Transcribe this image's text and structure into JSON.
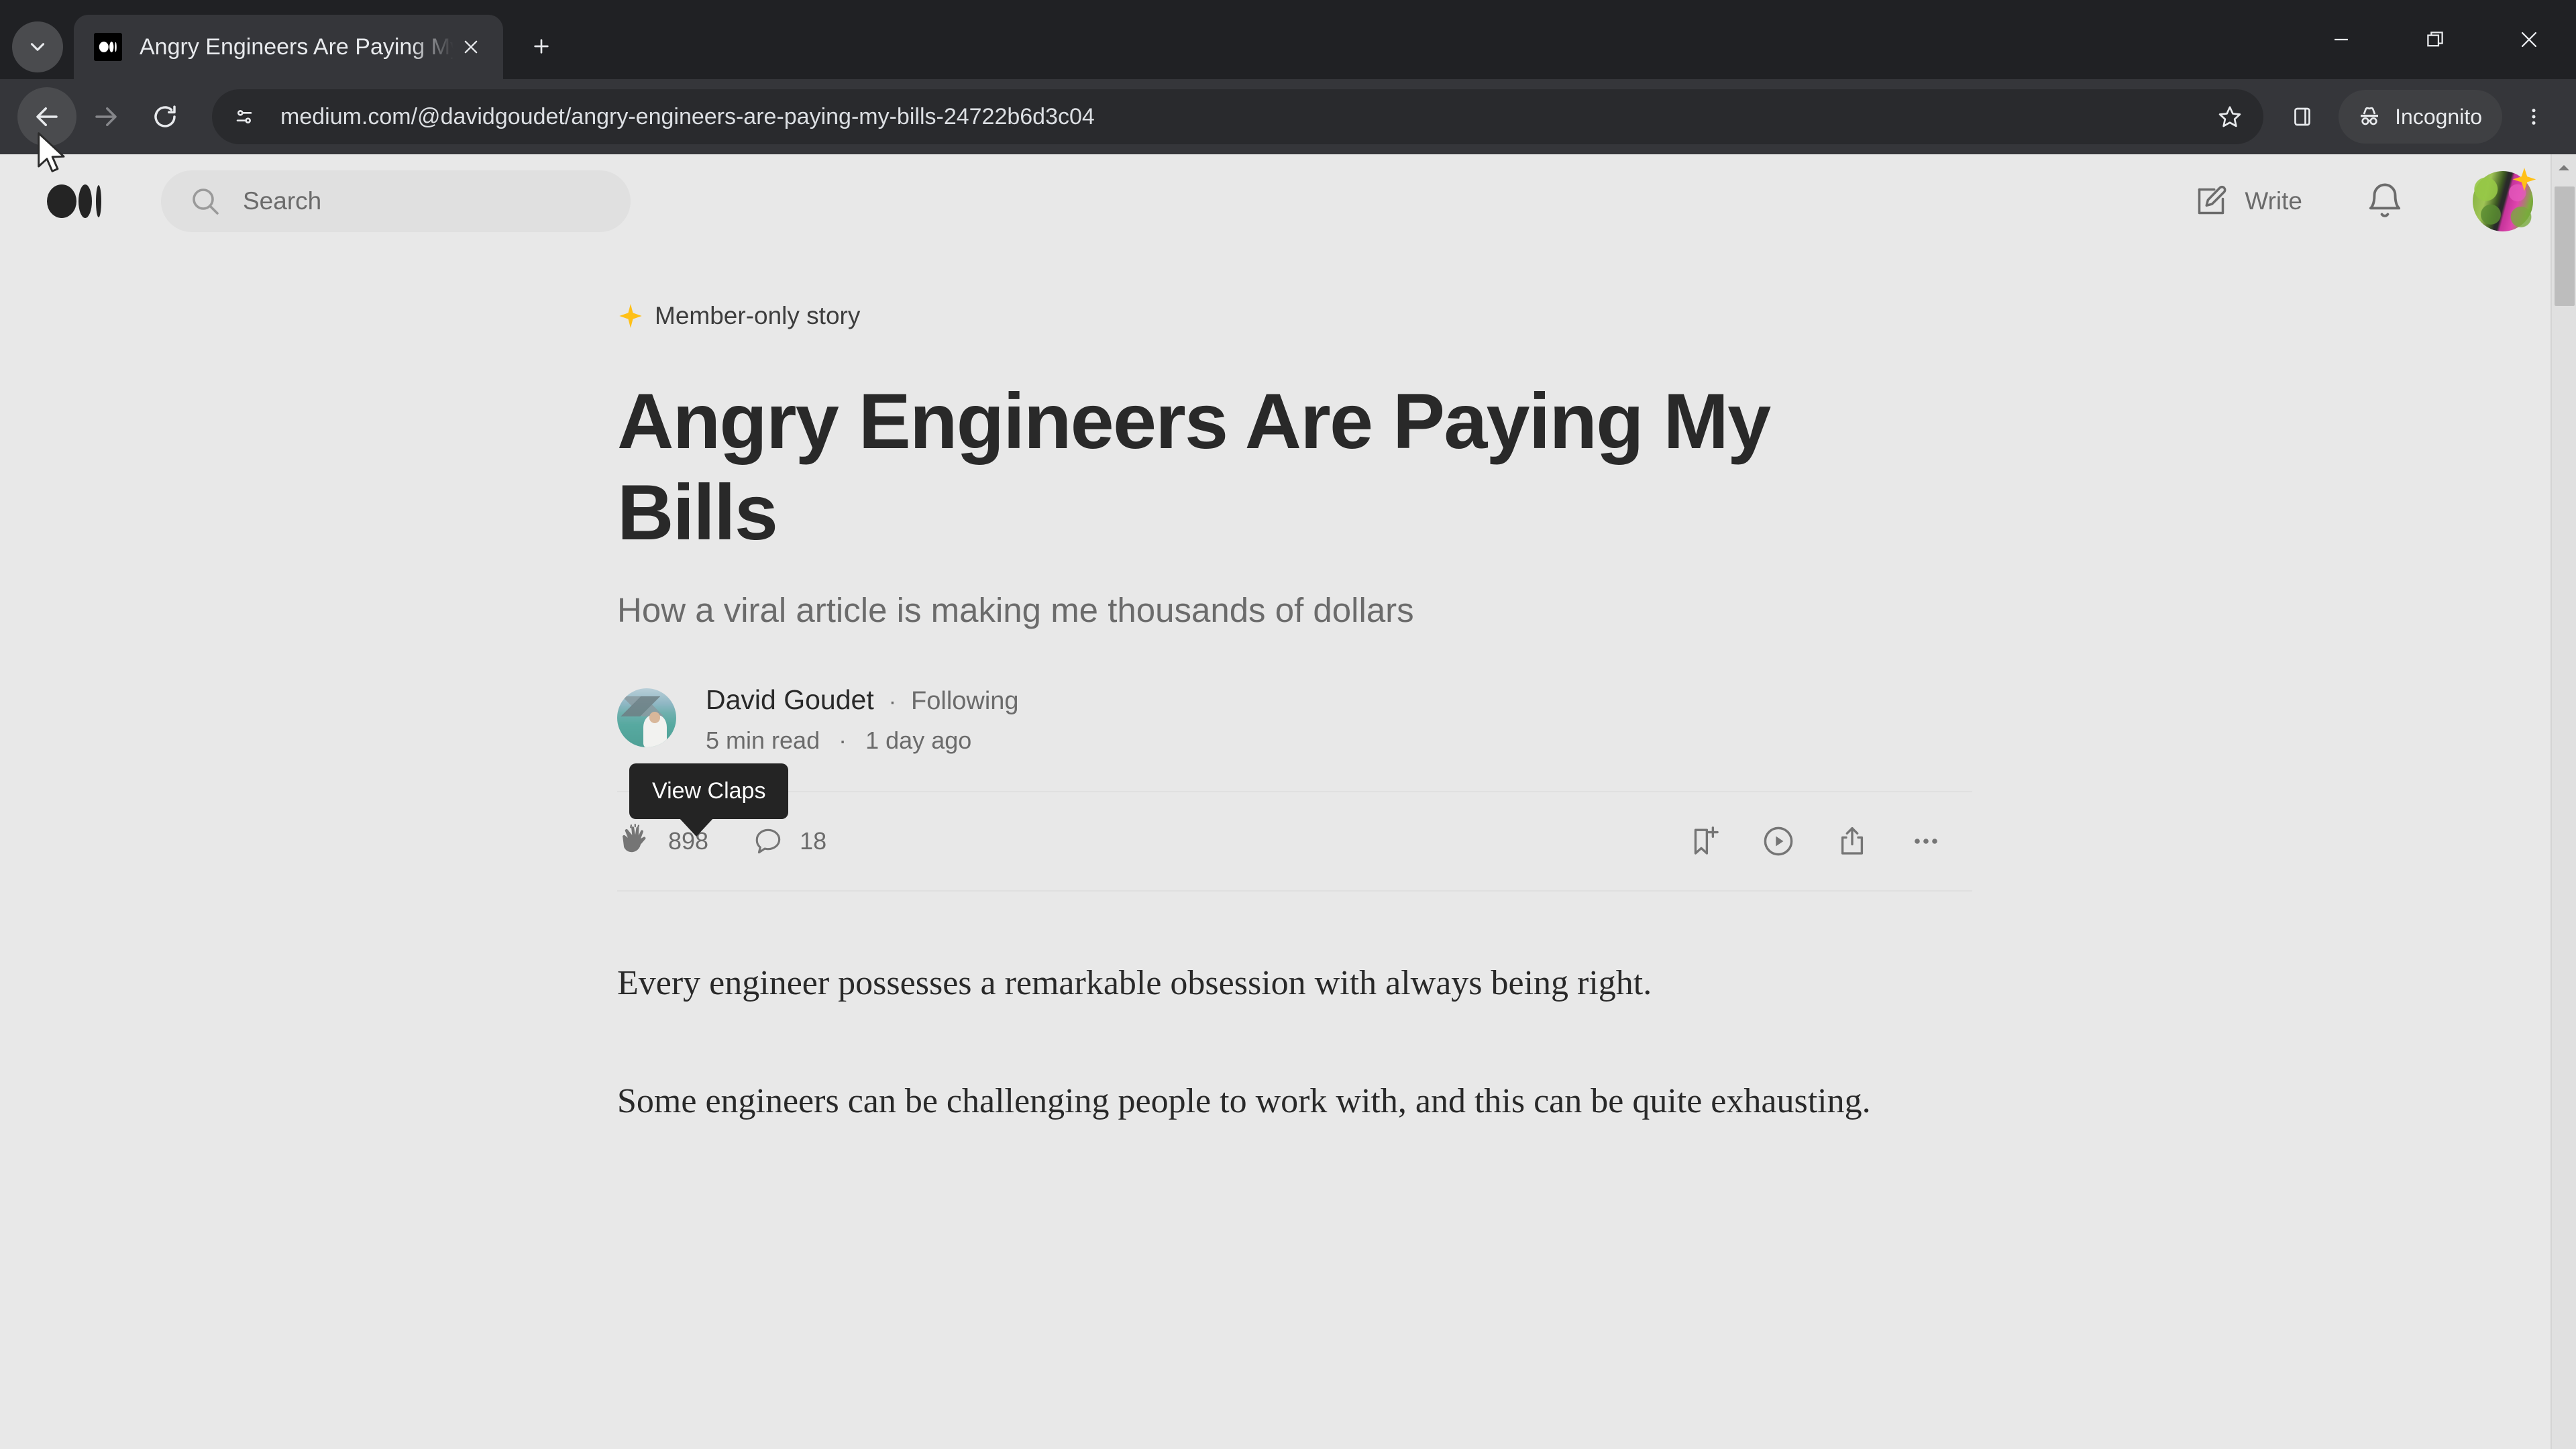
{
  "browser": {
    "tab": {
      "title": "Angry Engineers Are Paying My",
      "favicon_name": "medium-favicon"
    },
    "tab_search_label": "Search tabs",
    "new_tab_label": "New Tab",
    "close_tab_label": "Close",
    "window_controls": {
      "minimize": "Minimize",
      "maximize": "Restore",
      "close": "Close"
    },
    "toolbar": {
      "back_label": "Back",
      "forward_label": "Forward",
      "reload_label": "Reload",
      "site_info_label": "View site information",
      "url": "medium.com/@davidgoudet/angry-engineers-are-paying-my-bills-24722b6d3c04",
      "bookmark_label": "Bookmark this tab",
      "side_panel_label": "Side panel",
      "incognito_label": "Incognito",
      "menu_label": "Customize and control Google Chrome"
    }
  },
  "page": {
    "header": {
      "logo_name": "medium-logo",
      "search_placeholder": "Search",
      "write_label": "Write",
      "notifications_label": "Notifications",
      "avatar_label": "Account"
    },
    "article": {
      "member_badge": "Member-only story",
      "title": "Angry Engineers Are Paying My Bills",
      "subtitle": "How a viral article is making me thousands of dollars",
      "author": {
        "name": "David Goudet",
        "separator": "·",
        "follow_state": "Following",
        "read_time": "5 min read",
        "meta_separator": "·",
        "published": "1 day ago"
      },
      "tooltip": "View Claps",
      "actions": {
        "claps_count": "898",
        "responses_count": "18",
        "save_label": "Save",
        "listen_label": "Listen",
        "share_label": "Share",
        "more_label": "More options"
      },
      "paragraphs": [
        "Every engineer possesses a remarkable obsession with always being right.",
        "Some engineers can be challenging people to work with, and this can be quite exhausting."
      ]
    }
  },
  "colors": {
    "chrome_bg": "#35363a",
    "tabstrip_bg": "#202124",
    "omnibox_bg": "#292a2d",
    "page_bg": "#e8e8e8",
    "text_primary": "#292929",
    "text_secondary": "#6b6b6b",
    "member_star": "#ffc017",
    "tooltip_bg": "#242424"
  }
}
